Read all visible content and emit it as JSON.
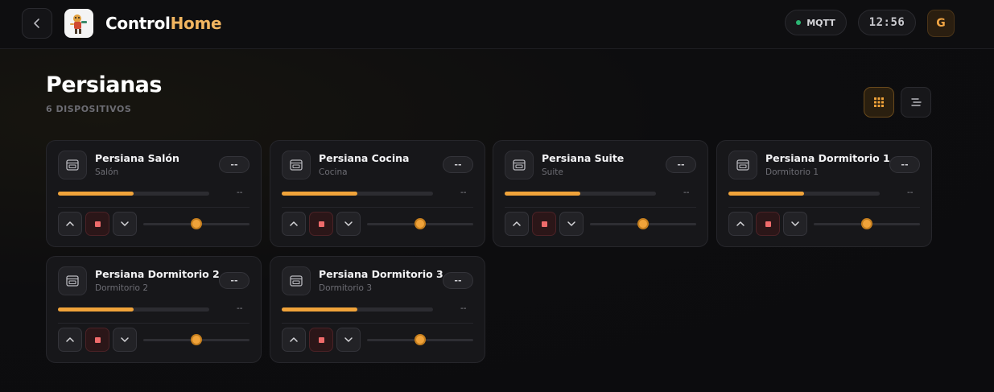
{
  "header": {
    "brand_part1": "Control",
    "brand_part2": "Home",
    "status_label": "MQTT",
    "time": "12:56",
    "avatar_initial": "G"
  },
  "page": {
    "title": "Persianas",
    "subtitle": "6 DISPOSITIVOS"
  },
  "colors": {
    "accent": "#f0a33a",
    "brand_highlight": "#f2b560",
    "status_online": "#2bb673",
    "stop": "#ef6b6b"
  },
  "devices": [
    {
      "name": "Persiana Salón",
      "room": "Salón",
      "badge": "--",
      "position_text": "--",
      "progress": 0.5,
      "slider": 0.5
    },
    {
      "name": "Persiana Cocina",
      "room": "Cocina",
      "badge": "--",
      "position_text": "--",
      "progress": 0.5,
      "slider": 0.5
    },
    {
      "name": "Persiana Suite",
      "room": "Suite",
      "badge": "--",
      "position_text": "--",
      "progress": 0.5,
      "slider": 0.5
    },
    {
      "name": "Persiana Dormitorio 1",
      "room": "Dormitorio 1",
      "badge": "--",
      "position_text": "--",
      "progress": 0.5,
      "slider": 0.5
    },
    {
      "name": "Persiana Dormitorio 2",
      "room": "Dormitorio 2",
      "badge": "--",
      "position_text": "--",
      "progress": 0.5,
      "slider": 0.5
    },
    {
      "name": "Persiana Dormitorio 3",
      "room": "Dormitorio 3",
      "badge": "--",
      "position_text": "--",
      "progress": 0.5,
      "slider": 0.5
    }
  ]
}
